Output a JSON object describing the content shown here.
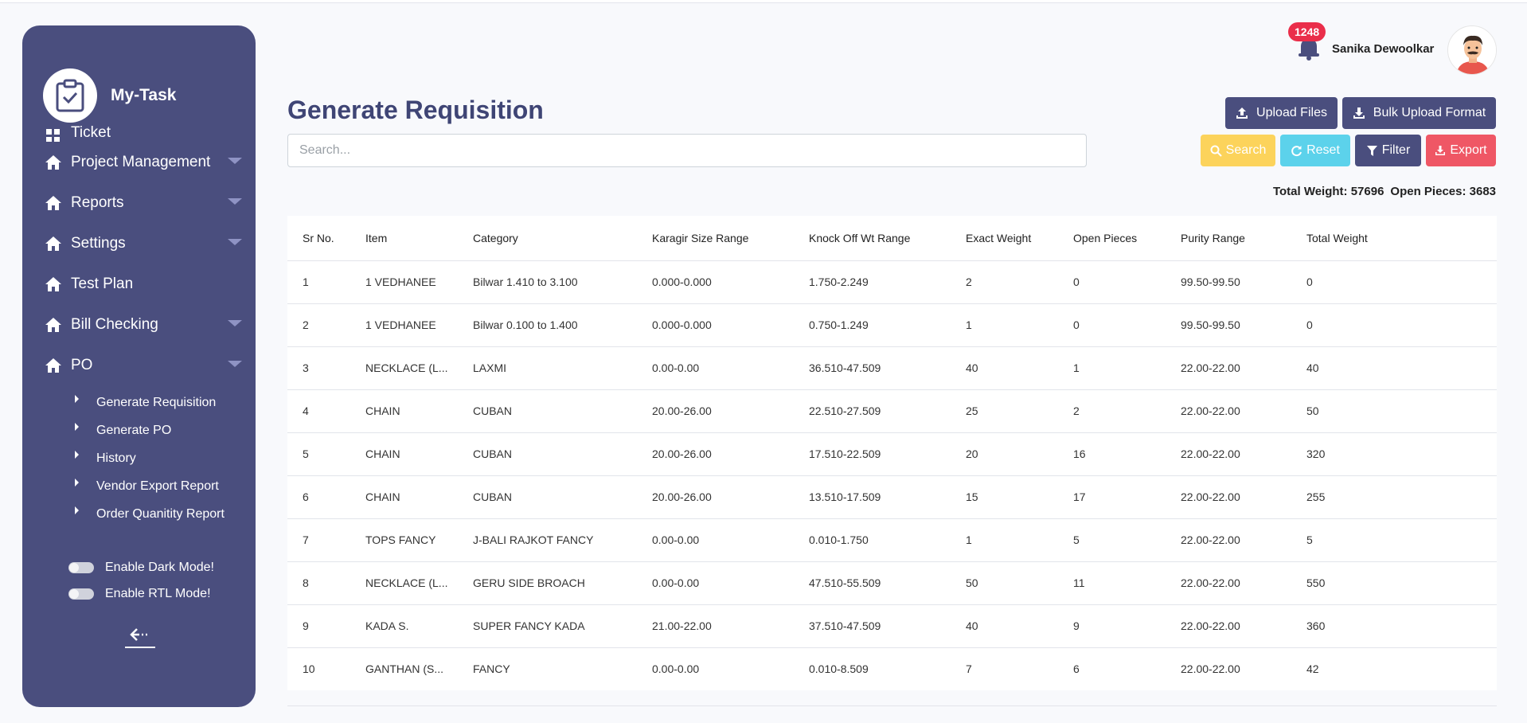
{
  "app": {
    "name": "My-Task"
  },
  "sidebar": {
    "items": [
      {
        "label": "Ticket",
        "has_caret": false
      },
      {
        "label": "Project Management",
        "has_caret": true
      },
      {
        "label": "Reports",
        "has_caret": true
      },
      {
        "label": "Settings",
        "has_caret": true
      },
      {
        "label": "Test Plan",
        "has_caret": false
      },
      {
        "label": "Bill Checking",
        "has_caret": true
      },
      {
        "label": "PO",
        "has_caret": true
      }
    ],
    "po_submenu": [
      "Generate Requisition",
      "Generate PO",
      "History",
      "Vendor Export Report",
      "Order Quanitity Report"
    ],
    "toggles": {
      "dark_mode": "Enable Dark Mode!",
      "rtl_mode": "Enable RTL Mode!"
    }
  },
  "header": {
    "notification_count": "1248",
    "user_name": "Sanika Dewoolkar"
  },
  "page": {
    "title": "Generate Requisition",
    "search_placeholder": "Search...",
    "buttons": {
      "upload": "Upload Files",
      "bulk": "Bulk Upload Format",
      "search": "Search",
      "reset": "Reset",
      "filter": "Filter",
      "export": "Export"
    },
    "totals": {
      "total_weight": "Total Weight: 57696",
      "open_pieces": "Open Pieces: 3683"
    }
  },
  "colors": {
    "sidebar": "#4a4e7e",
    "title": "#3f4575",
    "search_btn": "#fcd35b",
    "reset_btn": "#5cd2eb",
    "export_btn": "#ef5765",
    "badge": "#ea2e4a"
  },
  "table": {
    "columns": [
      "Sr No.",
      "Item",
      "Category",
      "Karagir Size Range",
      "Knock Off Wt Range",
      "Exact Weight",
      "Open Pieces",
      "Purity Range",
      "Total Weight"
    ],
    "rows": [
      [
        "1",
        "1 VEDHANEE",
        "Bilwar 1.410 to 3.100",
        "0.000-0.000",
        "1.750-2.249",
        "2",
        "0",
        "99.50-99.50",
        "0"
      ],
      [
        "2",
        "1 VEDHANEE",
        "Bilwar 0.100 to 1.400",
        "0.000-0.000",
        "0.750-1.249",
        "1",
        "0",
        "99.50-99.50",
        "0"
      ],
      [
        "3",
        "NECKLACE (L...",
        "LAXMI",
        "0.00-0.00",
        "36.510-47.509",
        "40",
        "1",
        "22.00-22.00",
        "40"
      ],
      [
        "4",
        "CHAIN",
        "CUBAN",
        "20.00-26.00",
        "22.510-27.509",
        "25",
        "2",
        "22.00-22.00",
        "50"
      ],
      [
        "5",
        "CHAIN",
        "CUBAN",
        "20.00-26.00",
        "17.510-22.509",
        "20",
        "16",
        "22.00-22.00",
        "320"
      ],
      [
        "6",
        "CHAIN",
        "CUBAN",
        "20.00-26.00",
        "13.510-17.509",
        "15",
        "17",
        "22.00-22.00",
        "255"
      ],
      [
        "7",
        "TOPS FANCY",
        "J-BALI RAJKOT FANCY",
        "0.00-0.00",
        "0.010-1.750",
        "1",
        "5",
        "22.00-22.00",
        "5"
      ],
      [
        "8",
        "NECKLACE (L...",
        "GERU SIDE BROACH",
        "0.00-0.00",
        "47.510-55.509",
        "50",
        "11",
        "22.00-22.00",
        "550"
      ],
      [
        "9",
        "KADA S.",
        "SUPER FANCY KADA",
        "21.00-22.00",
        "37.510-47.509",
        "40",
        "9",
        "22.00-22.00",
        "360"
      ],
      [
        "10",
        "GANTHAN (S...",
        "FANCY",
        "0.00-0.00",
        "0.010-8.509",
        "7",
        "6",
        "22.00-22.00",
        "42"
      ]
    ]
  }
}
